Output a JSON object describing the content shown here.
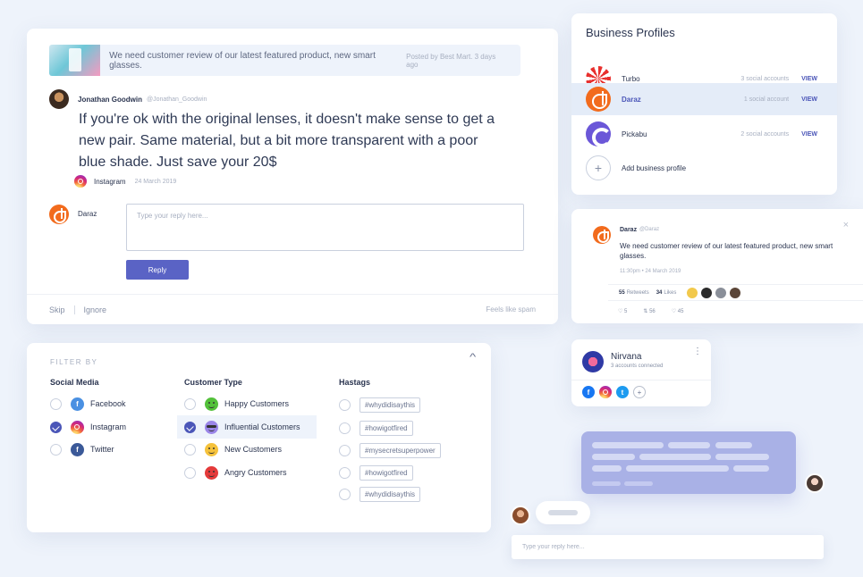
{
  "review": {
    "quote_text": "We need customer review of our latest featured product, new smart glasses.",
    "quote_meta": "Posted by Best Mart. 3 days ago",
    "author_name": "Jonathan Goodwin",
    "author_handle": "@Jonathan_Goodwin",
    "body": "If you're ok with the original lenses, it doesn't make sense to get a new pair. Same material, but a bit more transparent with a poor blue shade. Just save your 20$",
    "source": "Instagram",
    "date": "24 March 2019",
    "reply_name": "Daraz",
    "reply_placeholder": "Type your reply here...",
    "reply_button": "Reply",
    "skip": "Skip",
    "ignore": "Ignore",
    "spam": "Feels like spam"
  },
  "profiles": {
    "title": "Business Profiles",
    "items": [
      {
        "name": "Turbo",
        "count": "3 social accounts",
        "action": "VIEW",
        "logo": "turbo-logo"
      },
      {
        "name": "Daraz",
        "count": "1 social account",
        "action": "VIEW",
        "logo": "daraz-logo"
      },
      {
        "name": "Pickabu",
        "count": "2 social accounts",
        "action": "VIEW",
        "logo": "pickabu-logo"
      }
    ],
    "add_label": "Add business profile"
  },
  "tweet": {
    "close": "×",
    "name": "Daraz",
    "handle": "@Daraz",
    "text": "We need customer review of our latest featured product, new smart glasses.",
    "time": "11:30pm  •  24 March 2019",
    "retweets_count": "55",
    "retweets_label": "Retweets",
    "likes_count": "34",
    "likes_label": "Likes",
    "reply_count": "♡ 5",
    "retweet_action": "⇅ 56",
    "like_action": "♡ 45"
  },
  "nirvana": {
    "title": "Nirvana",
    "subtitle": "3 accounts connected",
    "more": "⋮",
    "icons": [
      "facebook-icon",
      "instagram-icon",
      "twitter-icon",
      "add-icon"
    ]
  },
  "filter": {
    "label": "FILTER BY",
    "social_head": "Social Media",
    "customer_head": "Customer Type",
    "hashtag_head": "Hastags",
    "social": [
      {
        "label": "Facebook",
        "checked": false
      },
      {
        "label": "Instagram",
        "checked": true
      },
      {
        "label": "Twitter",
        "checked": false
      }
    ],
    "customers": [
      {
        "label": "Happy Customers",
        "checked": false
      },
      {
        "label": "Influential Customers",
        "checked": true
      },
      {
        "label": "New Customers",
        "checked": false
      },
      {
        "label": "Angry Customers",
        "checked": false
      }
    ],
    "hashtags": [
      "#whydidisaythis",
      "#howigotfired",
      "#mysecretsuperpower",
      "#howigotfired",
      "#whydidisaythis"
    ]
  },
  "chat": {
    "input_placeholder": "Type your reply here..."
  },
  "colors": {
    "accent": "#5a63c5",
    "background": "#eef3fb",
    "chat_bubble": "#a9b1e6"
  }
}
